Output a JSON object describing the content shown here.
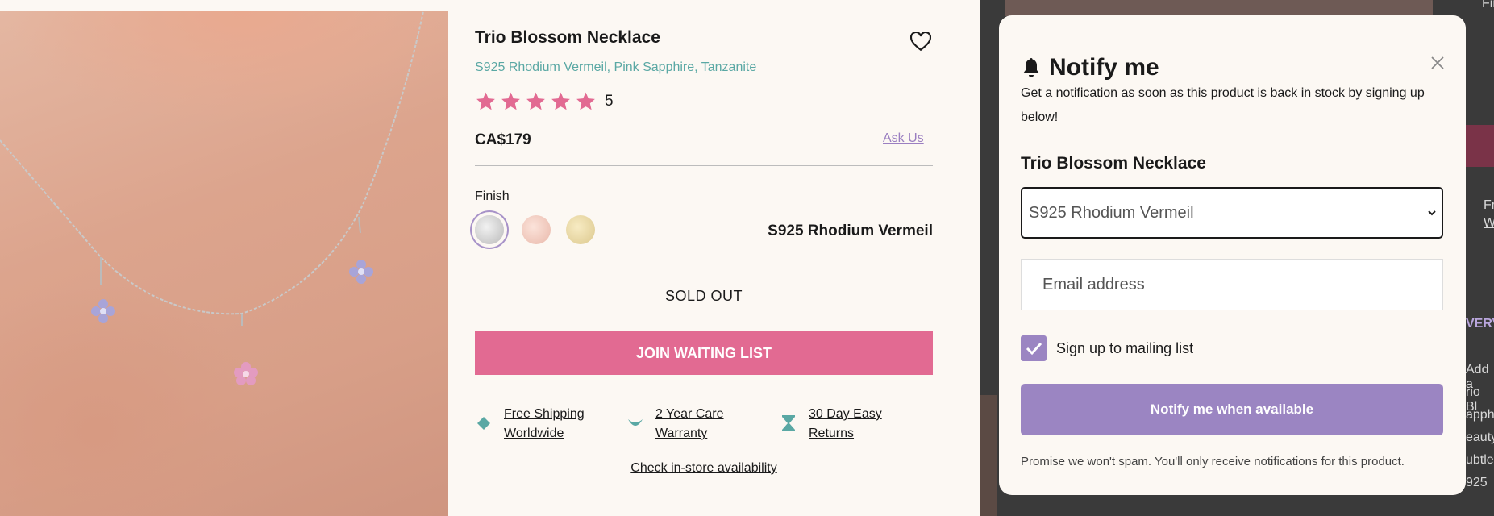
{
  "product": {
    "title": "Trio Blossom Necklace",
    "subtitle": "S925 Rhodium Vermeil, Pink Sapphire, Tanzanite",
    "rating": 5,
    "rating_count": "5",
    "price": "CA$179",
    "ask_label": "Ask Us",
    "finish_label": "Finish",
    "finish_selected": "S925 Rhodium Vermeil",
    "finish_options": [
      {
        "name": "silver",
        "color": "#c9c9c9"
      },
      {
        "name": "rose",
        "color": "#efc7bb"
      },
      {
        "name": "gold",
        "color": "#e6d6a2"
      }
    ],
    "sold_out": "SOLD OUT",
    "waitlist_button": "JOIN WAITING LIST",
    "perks": [
      {
        "icon": "diamond-icon",
        "line1": "Free Shipping",
        "line2": "Worldwide"
      },
      {
        "icon": "leaf-icon",
        "line1": "2 Year Care",
        "line2": "Warranty"
      },
      {
        "icon": "hourglass-icon",
        "line1": "30 Day Easy",
        "line2": "Returns"
      }
    ],
    "instore": "Check in-store availability"
  },
  "background_right": {
    "finish_fragment": "Finis",
    "overview_fragment": "VERVI",
    "shipping_frag": "Fr",
    "warranty_frag": "W",
    "desc_lines": [
      "Add a",
      "rio Bl",
      "apph",
      "eauty",
      "ubtle",
      "925"
    ]
  },
  "modal": {
    "title": "Notify me",
    "description": "Get a notification as soon as this product is back in stock by signing up below!",
    "product_name": "Trio Blossom Necklace",
    "variant_value": "S925 Rhodium Vermeil",
    "email_placeholder": "Email address",
    "mailing_label": "Sign up to mailing list",
    "mailing_checked": true,
    "submit_label": "Notify me when available",
    "fine_print": "Promise we won't spam. You'll only receive notifications for this product."
  },
  "colors": {
    "accent_pink": "#e26a92",
    "accent_purple": "#9b85c2",
    "teal": "#5aa8a4",
    "page_bg": "#fcf8f3"
  }
}
